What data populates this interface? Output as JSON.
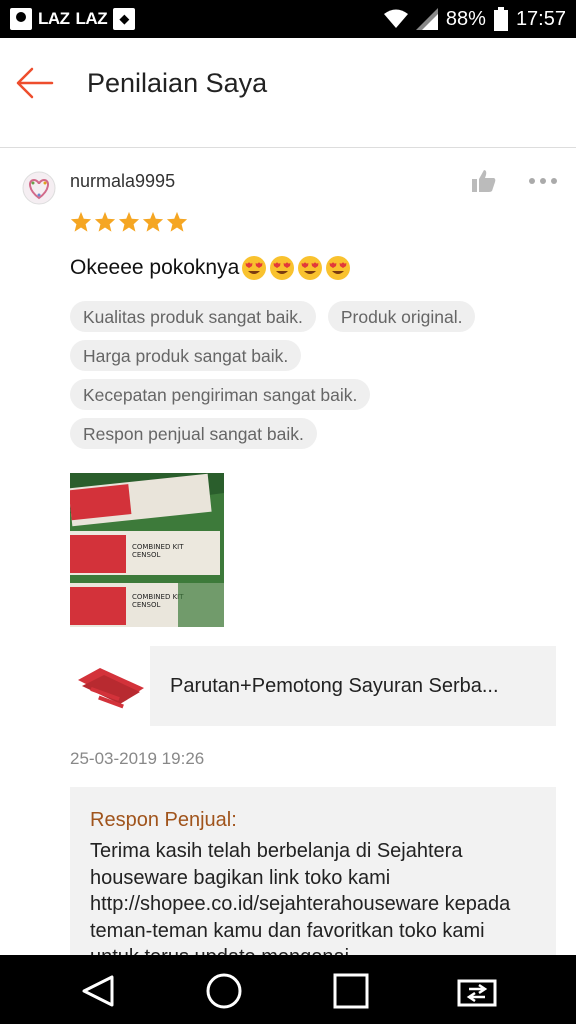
{
  "status_bar": {
    "left_labels": [
      "LAZ",
      "LAZ"
    ],
    "battery": "88%",
    "time": "17:57"
  },
  "header": {
    "title": "Penilaian Saya"
  },
  "review": {
    "username": "nurmala9995",
    "rating": 5,
    "comment": "Okeeee pokoknya",
    "emoji_count": 4,
    "tags": [
      [
        "Kualitas produk sangat baik.",
        "Produk original."
      ],
      [
        "Harga produk sangat baik."
      ],
      [
        "Kecepatan pengiriman sangat baik."
      ],
      [
        "Respon penjual sangat baik."
      ]
    ],
    "photo_labels": [
      "COMBINED KIT",
      "CENSOL",
      "COMBINED KIT",
      "CENSOL"
    ],
    "product_name": "Parutan+Pemotong Sayuran Serba...",
    "date": "25-03-2019 19:26",
    "seller_response": {
      "title": "Respon Penjual:",
      "text": "Terima kasih telah berbelanja di Sejahtera houseware bagikan link toko kami http://shopee.co.id/sejahterahouseware kepada teman-teman kamu dan favoritkan toko kami untuk terus update mengenai"
    }
  },
  "colors": {
    "accent": "#ee4d2d",
    "star": "#f5a623",
    "seller_title": "#a0541c"
  }
}
